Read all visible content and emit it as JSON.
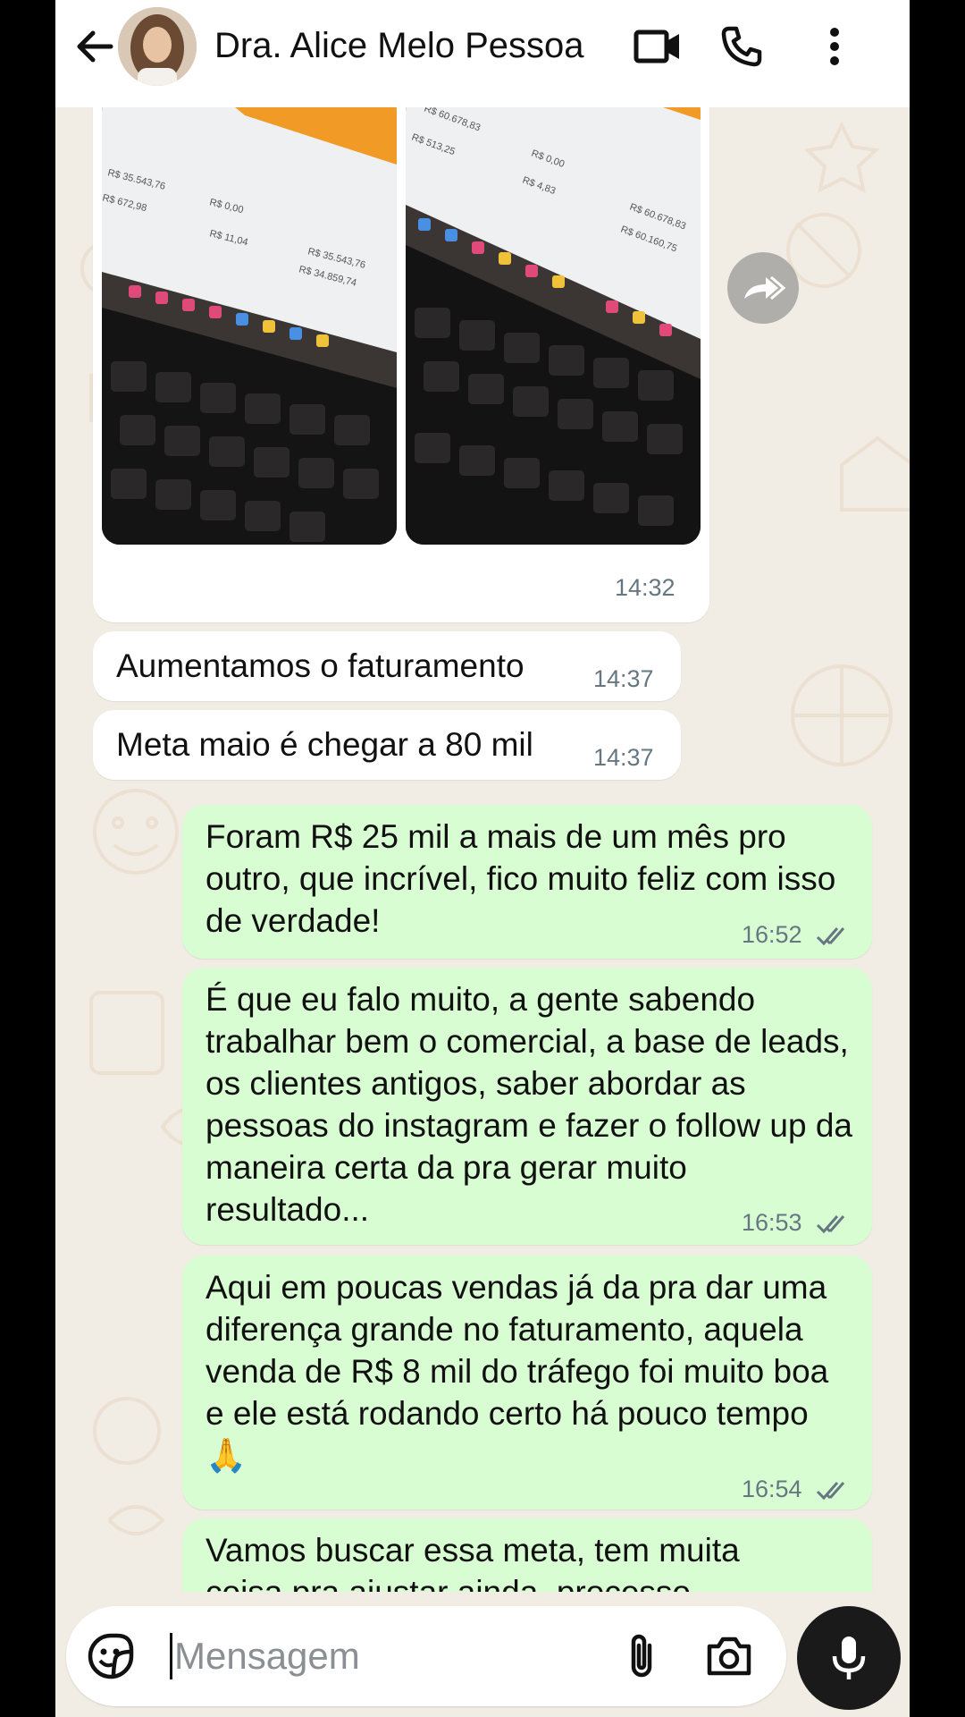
{
  "header": {
    "contact_name": "Dra. Alice Melo Pessoa",
    "icons": [
      "back-arrow-icon",
      "video-call-icon",
      "voice-call-icon",
      "more-options-icon"
    ]
  },
  "messages": [
    {
      "type": "images",
      "direction": "in",
      "time": "14:32",
      "images": [
        {
          "readings": [
            "R$ 35.543,76",
            "R$ 672,98",
            "R$ 0,00",
            "R$ 11,04",
            "R$ 35.543,76",
            "R$ 34.859,74"
          ]
        },
        {
          "readings": [
            "R$ 60.678,83",
            "R$ 513,25",
            "R$ 0,00",
            "R$ 4,83",
            "R$ 60.678,83",
            "R$ 60.160,75"
          ]
        }
      ]
    },
    {
      "type": "text",
      "direction": "in",
      "text": "Aumentamos o faturamento",
      "time": "14:37"
    },
    {
      "type": "text",
      "direction": "in",
      "text": "Meta maio é chegar a 80 mil",
      "time": "14:37"
    },
    {
      "type": "text",
      "direction": "out",
      "text": "Foram R$ 25 mil a mais de um mês pro outro, que incrível, fico muito feliz com isso de verdade!",
      "time": "16:52"
    },
    {
      "type": "text",
      "direction": "out",
      "text": "É que eu falo muito, a gente sabendo trabalhar bem o comercial, a base de leads, os clientes antigos, saber abordar as pessoas do instagram e fazer o follow up da maneira certa da pra gerar muito resultado...",
      "time": "16:53"
    },
    {
      "type": "text",
      "direction": "out",
      "text": "Aqui em poucas vendas já da pra dar uma diferença grande no faturamento, aquela venda de R$ 8 mil do tráfego foi muito boa e ele está rodando certo há pouco tempo 🙏",
      "time": "16:54"
    },
    {
      "type": "text",
      "direction": "out",
      "text": "Vamos buscar essa meta, tem muita coisa pra ajustar ainda, processo",
      "time": ""
    }
  ],
  "composer": {
    "placeholder": "Mensagem",
    "icons": [
      "emoji-sticker-icon",
      "attach-icon",
      "camera-icon",
      "microphone-icon"
    ]
  },
  "colors": {
    "incoming_bubble": "#ffffff",
    "outgoing_bubble": "#d9fdd3",
    "read_ticks": "#667781",
    "wallpaper": "#f2ede4"
  }
}
